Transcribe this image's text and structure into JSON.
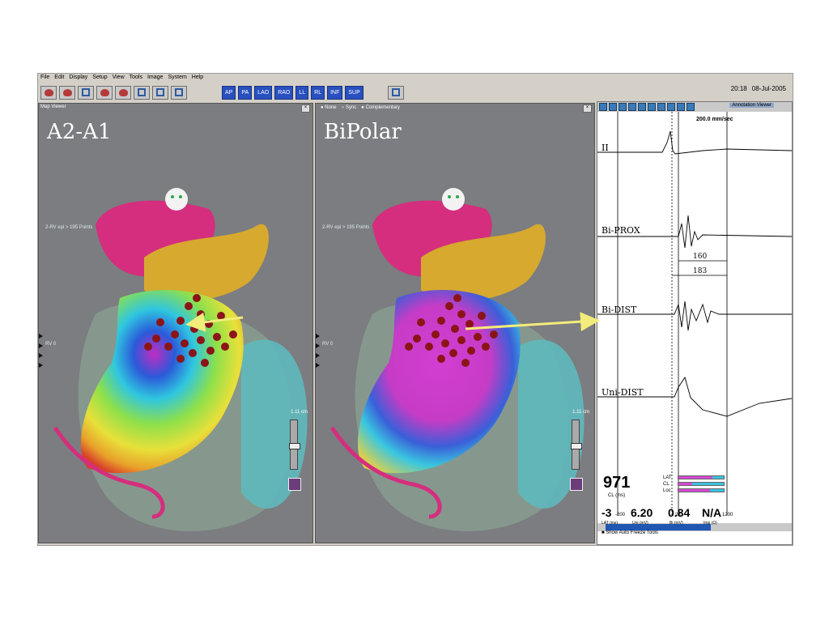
{
  "menu": [
    "File",
    "Edit",
    "Display",
    "Setup",
    "View",
    "Tools",
    "Image",
    "System",
    "Help"
  ],
  "views": [
    "AP",
    "PA",
    "LAO",
    "RAO",
    "LL",
    "RL",
    "INF",
    "SUP"
  ],
  "clock": {
    "time": "20:18",
    "date": "08-Jul-2005"
  },
  "left_pane": {
    "window_title": "Map Viewer",
    "map_title": "A2-A1",
    "points_label": "2-RV epi > 195 Points",
    "rv_label": "RV 0",
    "scale": "1.11 cm"
  },
  "right_pane": {
    "radios": [
      "None",
      "Sync",
      "Complementary"
    ],
    "map_title": "BiPolar",
    "points_label": "2-RV epi > 195 Points",
    "rv_label": "RV 0",
    "scale": "1.11 cm"
  },
  "annotation": {
    "title": "Annotation Viewer",
    "speed": "200.0 mm/sec",
    "traces": [
      "II",
      "Bi-PROX",
      "Bi-DIST",
      "Uni-DIST"
    ],
    "interval_1": "160",
    "interval_2": "183",
    "axis": [
      "-200",
      "23",
      "1200"
    ]
  },
  "stats": {
    "cl": "971",
    "cl_unit": "CL (ms)",
    "bars": [
      {
        "label": "LAT",
        "fill": 0.25
      },
      {
        "label": "CL",
        "fill": 0.7
      },
      {
        "label": "Loc",
        "fill": 0.3
      }
    ],
    "lat": "-3",
    "lat_unit": "LAT (ms)",
    "uni": "6.20",
    "uni_unit": "Uni (mV)",
    "bi": "0.84",
    "bi_unit": "Bi (mV)",
    "imp": "N/A",
    "imp_unit": "Imp (Ω)",
    "auto_freeze": "Show Auto Freeze Tools"
  },
  "colors": {
    "accent": "#2850c0",
    "arrow": "#f2ec7a",
    "pane_bg": "#7b7d80"
  }
}
